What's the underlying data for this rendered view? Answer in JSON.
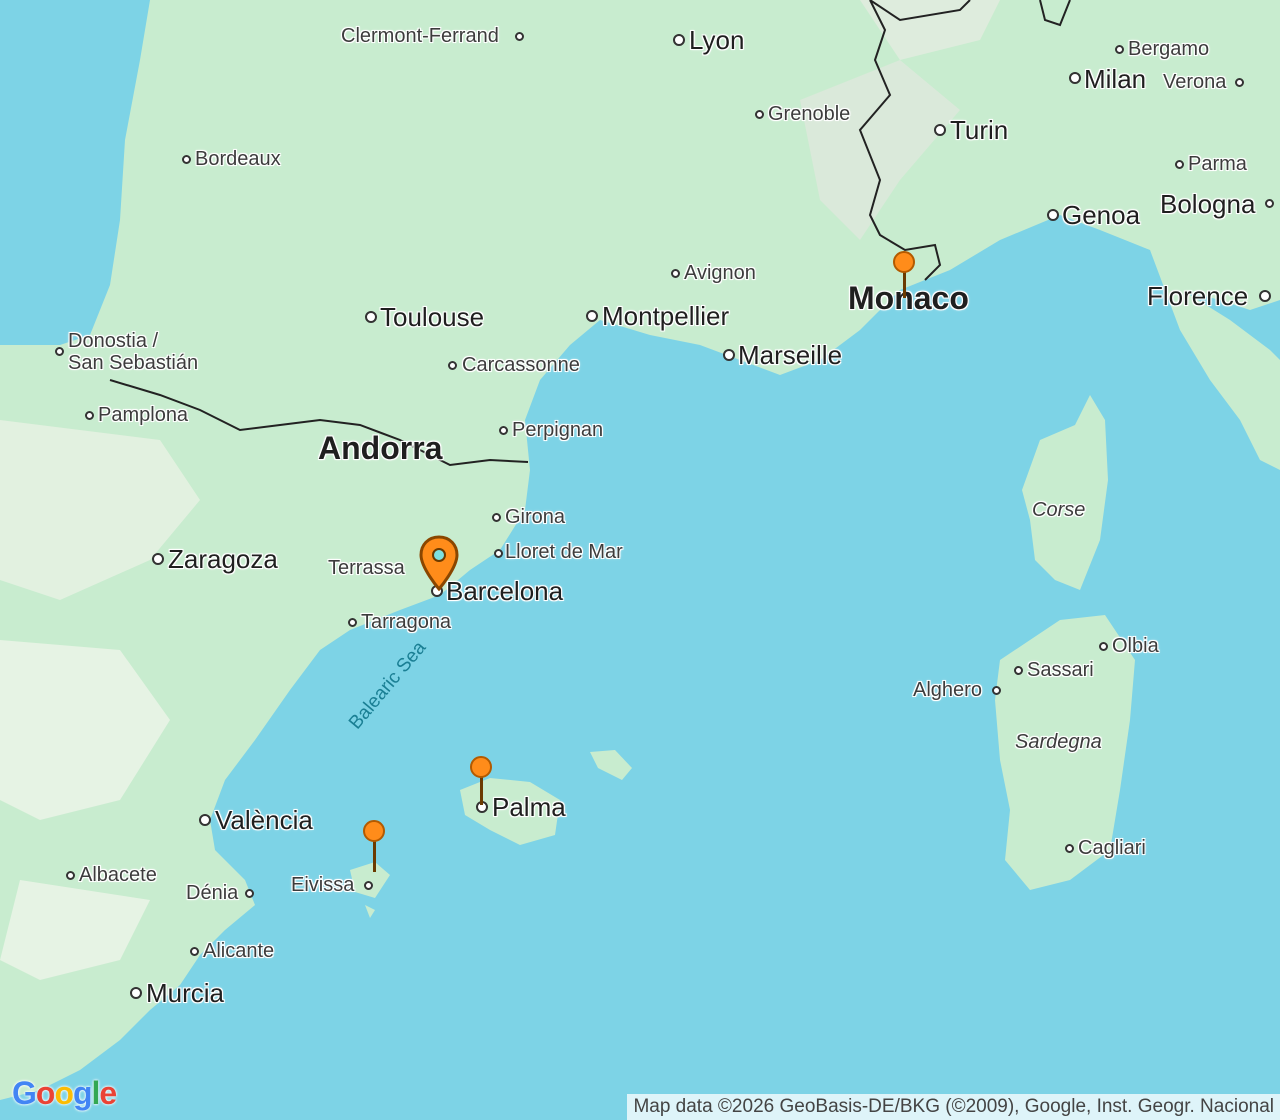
{
  "map": {
    "labels": {
      "clermont": "Clermont-Ferrand",
      "lyon": "Lyon",
      "bergamo": "Bergamo",
      "milan": "Milan",
      "verona": "Verona",
      "grenoble": "Grenoble",
      "turin": "Turin",
      "bordeaux": "Bordeaux",
      "parma": "Parma",
      "genoa": "Genoa",
      "bologna": "Bologna",
      "avignon": "Avignon",
      "monaco": "Monaco",
      "florence": "Florence",
      "toulouse": "Toulouse",
      "montpellier": "Montpellier",
      "donostia": "Donostia /",
      "sansebastian": "San Sebastián",
      "carcassonne": "Carcassonne",
      "marseille": "Marseille",
      "pamplona": "Pamplona",
      "perpignan": "Perpignan",
      "andorra": "Andorra",
      "corse": "Corse",
      "girona": "Girona",
      "lloret": "Lloret de Mar",
      "zaragoza": "Zaragoza",
      "terrassa": "Terrassa",
      "barcelona": "Barcelona",
      "tarragona": "Tarragona",
      "olbia": "Olbia",
      "sassari": "Sassari",
      "alghero": "Alghero",
      "balearic": "Balearic Sea",
      "sardegna": "Sardegna",
      "palma": "Palma",
      "valencia": "València",
      "cagliari": "Cagliari",
      "albacete": "Albacete",
      "eivissa": "Eivissa",
      "denia": "Dénia",
      "alicante": "Alicante",
      "murcia": "Murcia"
    },
    "attribution": "Map data ©2026 GeoBasis-DE/BKG (©2009), Google, Inst. Geogr. Nacional",
    "logo": "Google",
    "colors": {
      "sea": "#7dd3e6",
      "land": "#c8eccf",
      "pin": "#ff8c1a"
    }
  }
}
